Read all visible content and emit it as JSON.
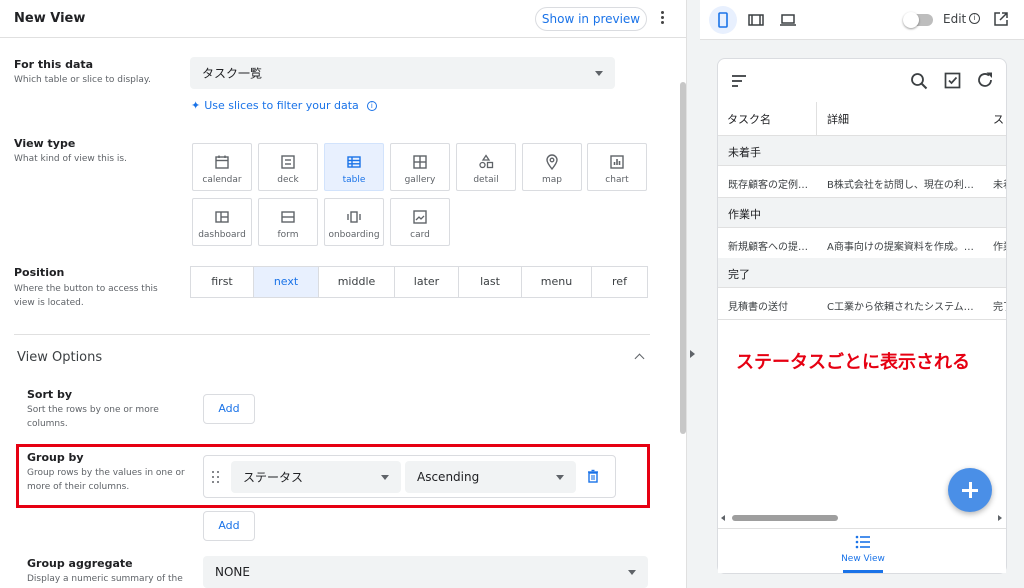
{
  "editor": {
    "view_name": "New View",
    "show_in_preview": "Show in preview",
    "for_this_data": {
      "label": "For this data",
      "help": "Which table or slice to display.",
      "value": "タスク一覧",
      "slice_link": "Use slices to filter your data"
    },
    "view_type": {
      "label": "View type",
      "help": "What kind of view this is.",
      "selected": "table",
      "options": [
        {
          "name": "calendar",
          "icon": "calendar-icon"
        },
        {
          "name": "deck",
          "icon": "deck-icon"
        },
        {
          "name": "table",
          "icon": "table-icon"
        },
        {
          "name": "gallery",
          "icon": "gallery-icon"
        },
        {
          "name": "detail",
          "icon": "detail-icon"
        },
        {
          "name": "map",
          "icon": "map-pin-icon"
        },
        {
          "name": "chart",
          "icon": "chart-icon"
        },
        {
          "name": "dashboard",
          "icon": "dashboard-icon"
        },
        {
          "name": "form",
          "icon": "form-icon"
        },
        {
          "name": "onboarding",
          "icon": "onboarding-icon"
        },
        {
          "name": "card",
          "icon": "card-icon"
        }
      ]
    },
    "position": {
      "label": "Position",
      "help": "Where the button to access this view is located.",
      "selected": "next",
      "options": [
        "first",
        "next",
        "middle",
        "later",
        "last",
        "menu",
        "ref"
      ]
    },
    "view_options": {
      "title": "View Options",
      "sort_by": {
        "label": "Sort by",
        "help": "Sort the rows by one or more columns.",
        "add": "Add"
      },
      "group_by": {
        "label": "Group by",
        "help": "Group rows by the values in one or more of their columns.",
        "column": "ステータス",
        "order": "Ascending",
        "add": "Add"
      },
      "group_aggregate": {
        "label": "Group aggregate",
        "help": "Display a numeric summary of the",
        "value": "NONE"
      }
    }
  },
  "preview": {
    "edit_label": "Edit",
    "columns": [
      "タスク名",
      "詳細",
      "ス"
    ],
    "groups": [
      {
        "name": "未着手",
        "row": [
          "既存顧客の定例…",
          "B株式会社を訪問し、現在の利…",
          "未着"
        ]
      },
      {
        "name": "作業中",
        "row": [
          "新規顧客への提…",
          "A商事向けの提案資料を作成。…",
          "作業"
        ]
      },
      {
        "name": "完了",
        "row": [
          "見積書の送付",
          "C工業から依頼されたシステム…",
          "完了"
        ]
      }
    ],
    "annotation": "ステータスごとに表示される",
    "nav_label": "New View"
  },
  "colors": {
    "accent": "#1a73e8",
    "highlight_red": "#e60012",
    "fab": "#4a8fe7"
  }
}
